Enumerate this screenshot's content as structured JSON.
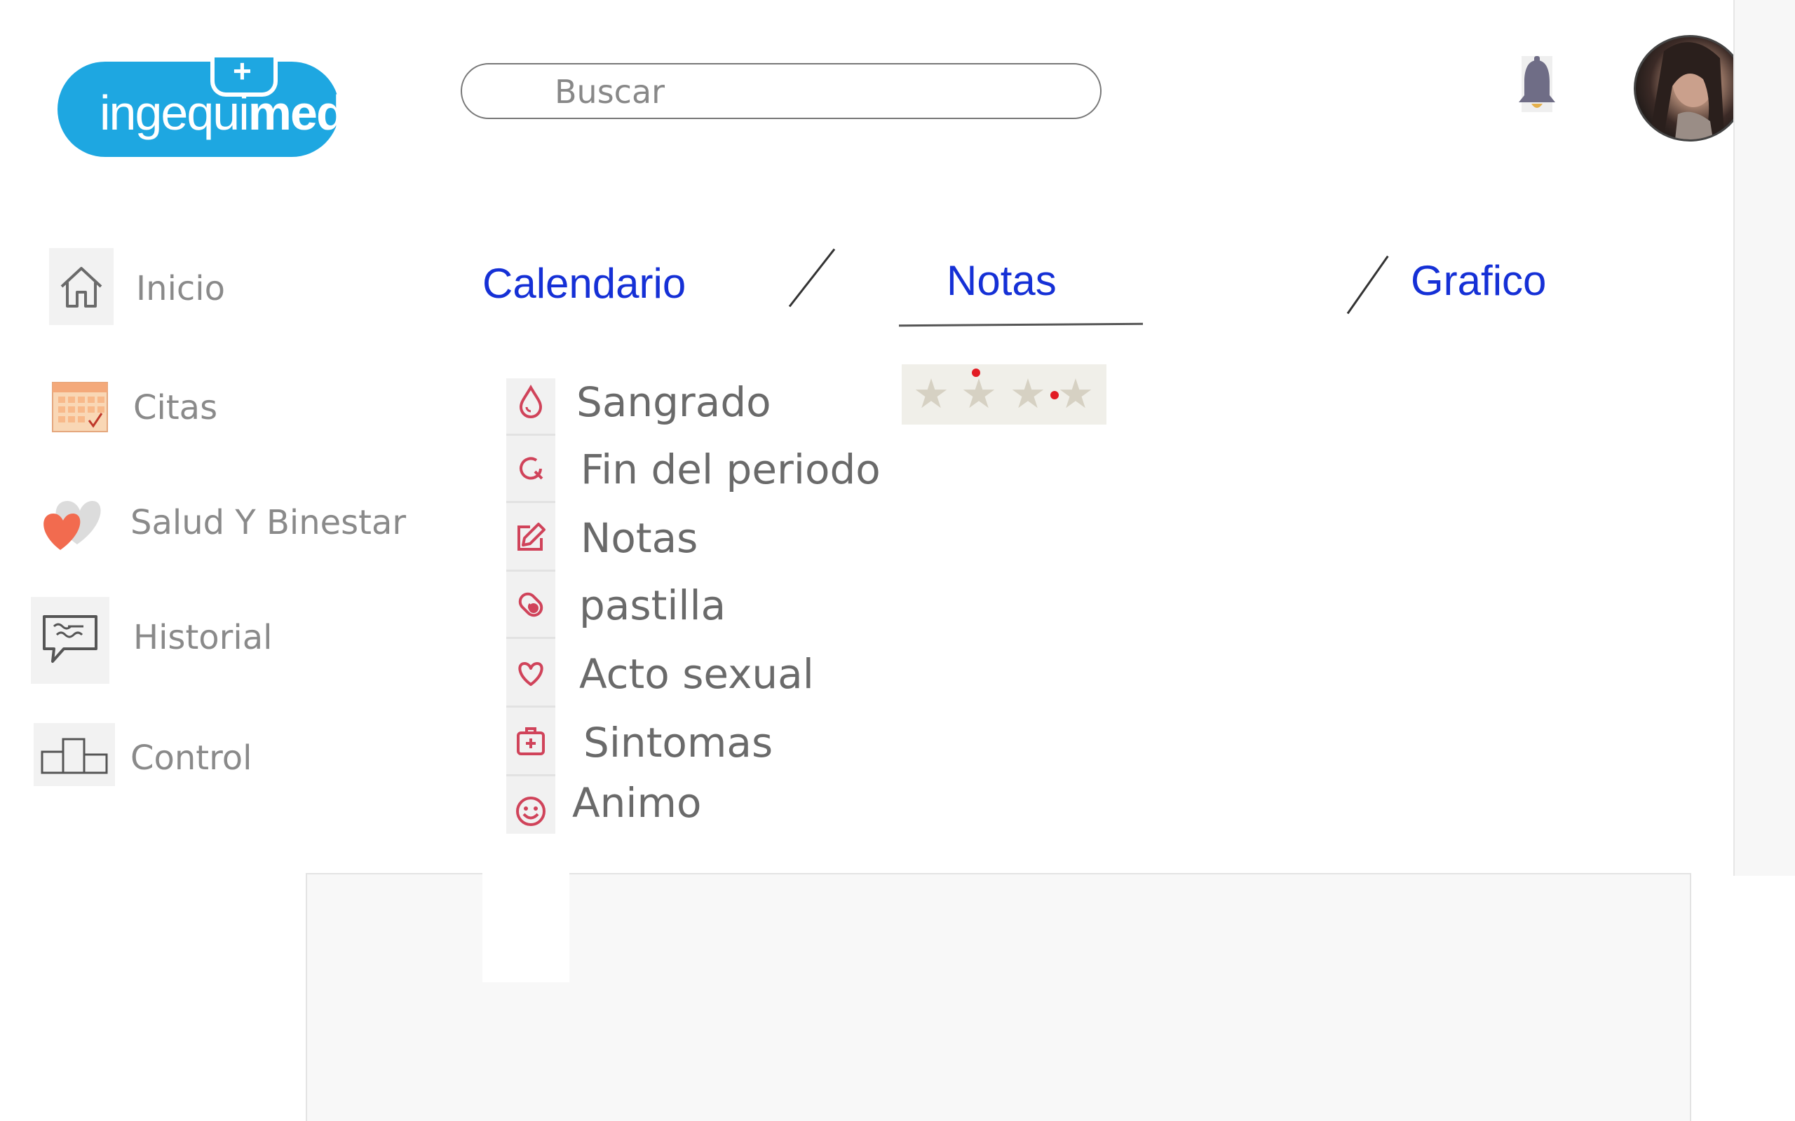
{
  "app": {
    "logo_text_light": "ingequi",
    "logo_text_bold": "med",
    "logo_bubble": "+"
  },
  "search": {
    "placeholder": "Buscar",
    "value": ""
  },
  "header": {
    "bell_icon": "bell-icon",
    "avatar": "user-avatar"
  },
  "sidebar": {
    "items": [
      {
        "label": "Inicio",
        "icon": "home-icon"
      },
      {
        "label": "Citas",
        "icon": "calendar-icon"
      },
      {
        "label": "Salud Y Binestar",
        "icon": "heart-icon"
      },
      {
        "label": "Historial",
        "icon": "chat-icon"
      },
      {
        "label": "Control",
        "icon": "podium-icon"
      }
    ]
  },
  "tabs": [
    {
      "label": "Calendario",
      "active": false
    },
    {
      "label": "Notas",
      "active": true
    },
    {
      "label": "Grafico",
      "active": false
    }
  ],
  "menu": {
    "items": [
      {
        "label": "Sangrado",
        "icon": "drop-icon"
      },
      {
        "label": "Fin del periodo",
        "icon": "refresh-icon"
      },
      {
        "label": "Notas",
        "icon": "edit-icon"
      },
      {
        "label": "pastilla",
        "icon": "pill-icon"
      },
      {
        "label": "Acto sexual",
        "icon": "heart-outline-icon"
      },
      {
        "label": "Sintomas",
        "icon": "medkit-icon"
      },
      {
        "label": "Animo",
        "icon": "smiley-icon"
      }
    ]
  },
  "rating": {
    "stars_total": 4
  },
  "colors": {
    "brand": "#1ea7e1",
    "tab": "#1530d6",
    "accent_icon": "#d0435a",
    "dot": "#e21c24"
  }
}
